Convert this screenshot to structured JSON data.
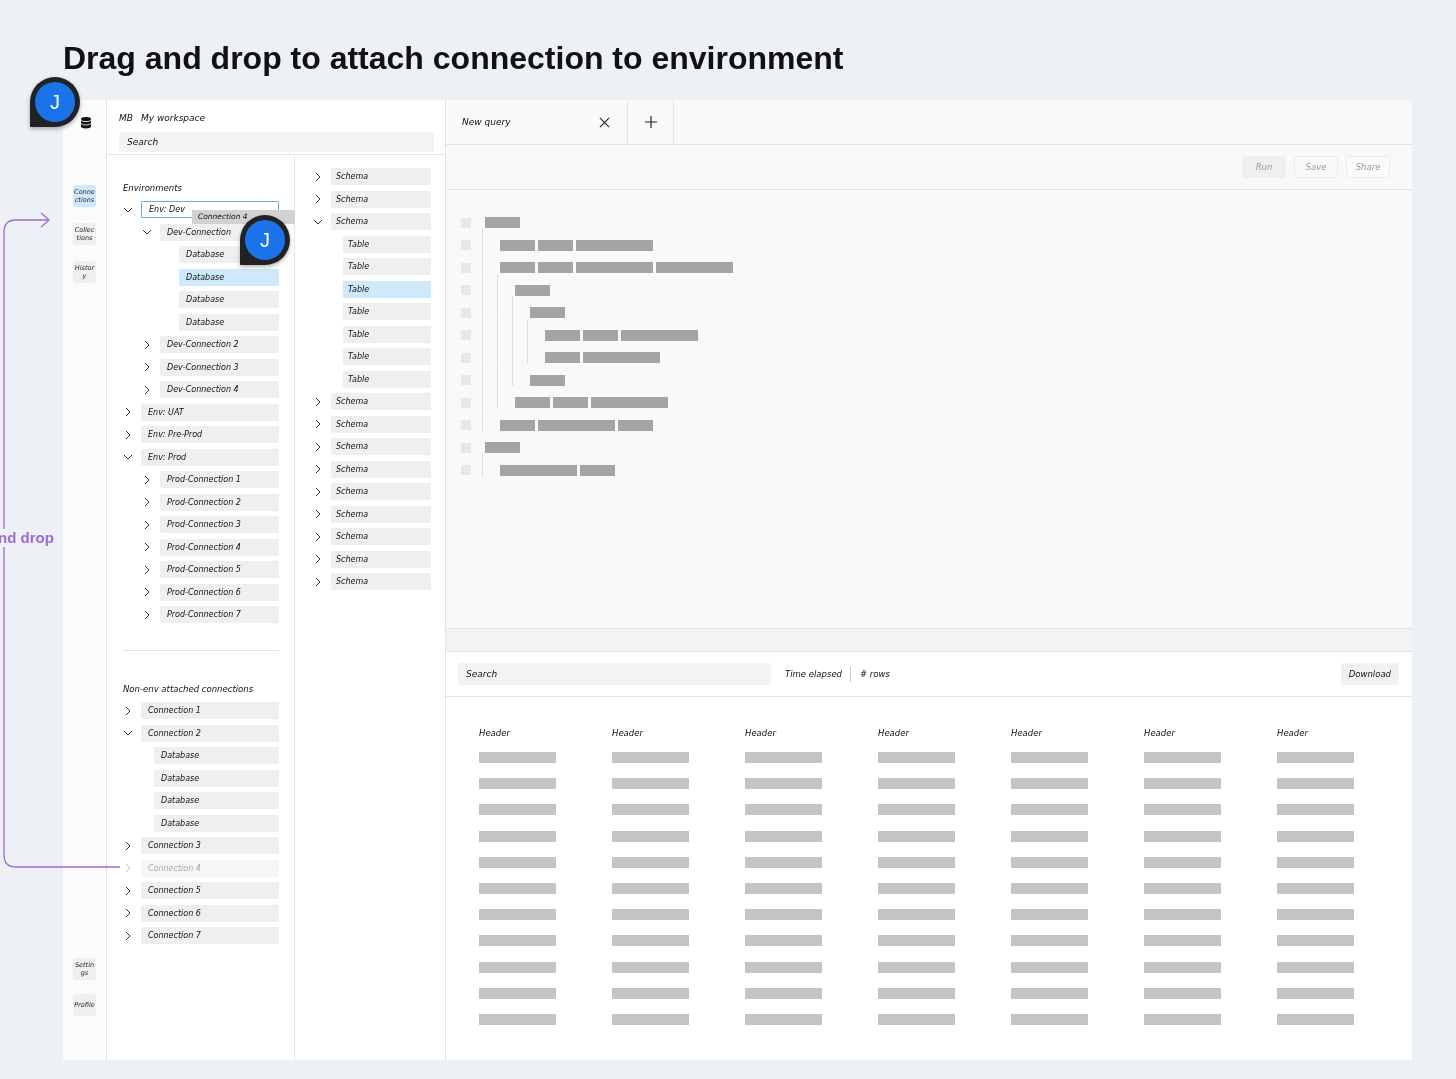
{
  "title": "Drag and drop to attach connection to environment",
  "annotation": {
    "label": "nd drop"
  },
  "cursors": [
    {
      "initial": "J"
    },
    {
      "initial": "J"
    }
  ],
  "rail": {
    "top": [
      {
        "label": "Connections",
        "selected": true
      },
      {
        "label": "Collections",
        "selected": false
      },
      {
        "label": "History",
        "selected": false
      }
    ],
    "bottom": [
      {
        "label": "Settings",
        "selected": false
      },
      {
        "label": "Profile",
        "selected": false
      }
    ]
  },
  "workspace": {
    "initials": "MB",
    "name": "My workspace"
  },
  "search": {
    "placeholder": "Search"
  },
  "environments": {
    "title": "Environments",
    "items": [
      {
        "label": "Env: Dev",
        "expanded": true,
        "drop_target": true,
        "children": [
          {
            "label": "Dev-Connection",
            "expanded": true,
            "children": [
              {
                "label": "Database",
                "selected": false
              },
              {
                "label": "Database",
                "selected": true
              },
              {
                "label": "Database",
                "selected": false
              },
              {
                "label": "Database",
                "selected": false
              }
            ]
          },
          {
            "label": "Dev-Connection 2",
            "expanded": false
          },
          {
            "label": "Dev-Connection 3",
            "expanded": false
          },
          {
            "label": "Dev-Connection 4",
            "expanded": false
          }
        ]
      },
      {
        "label": "Env: UAT",
        "expanded": false,
        "drop_target": false
      },
      {
        "label": "Env: Pre-Prod",
        "expanded": false,
        "drop_target": false
      },
      {
        "label": "Env: Prod",
        "expanded": true,
        "drop_target": false,
        "children": [
          {
            "label": "Prod-Connection 1",
            "expanded": false
          },
          {
            "label": "Prod-Connection 2",
            "expanded": false
          },
          {
            "label": "Prod-Connection 3",
            "expanded": false
          },
          {
            "label": "Prod-Connection 4",
            "expanded": false
          },
          {
            "label": "Prod-Connection 5",
            "expanded": false
          },
          {
            "label": "Prod-Connection 6",
            "expanded": false
          },
          {
            "label": "Prod-Connection 7",
            "expanded": false
          }
        ]
      }
    ]
  },
  "drag_ghost": {
    "label": "Connection 4"
  },
  "non_env": {
    "title": "Non-env attached connections",
    "items": [
      {
        "label": "Connection 1",
        "expanded": false,
        "dimmed": false
      },
      {
        "label": "Connection 2",
        "expanded": true,
        "dimmed": false,
        "children": [
          {
            "label": "Database",
            "selected": false
          },
          {
            "label": "Database",
            "selected": false
          },
          {
            "label": "Database",
            "selected": false
          },
          {
            "label": "Database",
            "selected": false
          }
        ]
      },
      {
        "label": "Connection 3",
        "expanded": false,
        "dimmed": false
      },
      {
        "label": "Connection 4",
        "expanded": false,
        "dimmed": true
      },
      {
        "label": "Connection 5",
        "expanded": false,
        "dimmed": false
      },
      {
        "label": "Connection 6",
        "expanded": false,
        "dimmed": false
      },
      {
        "label": "Connection 7",
        "expanded": false,
        "dimmed": false
      }
    ]
  },
  "schemas": [
    {
      "label": "Schema",
      "expanded": false
    },
    {
      "label": "Schema",
      "expanded": false
    },
    {
      "label": "Schema",
      "expanded": true,
      "children": [
        {
          "label": "Table",
          "selected": false
        },
        {
          "label": "Table",
          "selected": false
        },
        {
          "label": "Table",
          "selected": true
        },
        {
          "label": "Table",
          "selected": false
        },
        {
          "label": "Table",
          "selected": false
        },
        {
          "label": "Table",
          "selected": false
        },
        {
          "label": "Table",
          "selected": false
        }
      ]
    },
    {
      "label": "Schema",
      "expanded": false
    },
    {
      "label": "Schema",
      "expanded": false
    },
    {
      "label": "Schema",
      "expanded": false
    },
    {
      "label": "Schema",
      "expanded": false
    },
    {
      "label": "Schema",
      "expanded": false
    },
    {
      "label": "Schema",
      "expanded": false
    },
    {
      "label": "Schema",
      "expanded": false
    },
    {
      "label": "Schema",
      "expanded": false
    },
    {
      "label": "Schema",
      "expanded": false
    }
  ],
  "tabs": [
    {
      "label": "New query",
      "selected": true
    }
  ],
  "toolbar": {
    "buttons": [
      {
        "label": "Run",
        "kind": "filled"
      },
      {
        "label": "Save",
        "kind": "outline"
      },
      {
        "label": "Share",
        "kind": "outline"
      }
    ]
  },
  "results": {
    "search_placeholder": "Search",
    "time_label": "Time elapsed",
    "rows_label": "# rows",
    "download": "Download",
    "headers": [
      "Header",
      "Header",
      "Header",
      "Header",
      "Header",
      "Header",
      "Header"
    ]
  }
}
